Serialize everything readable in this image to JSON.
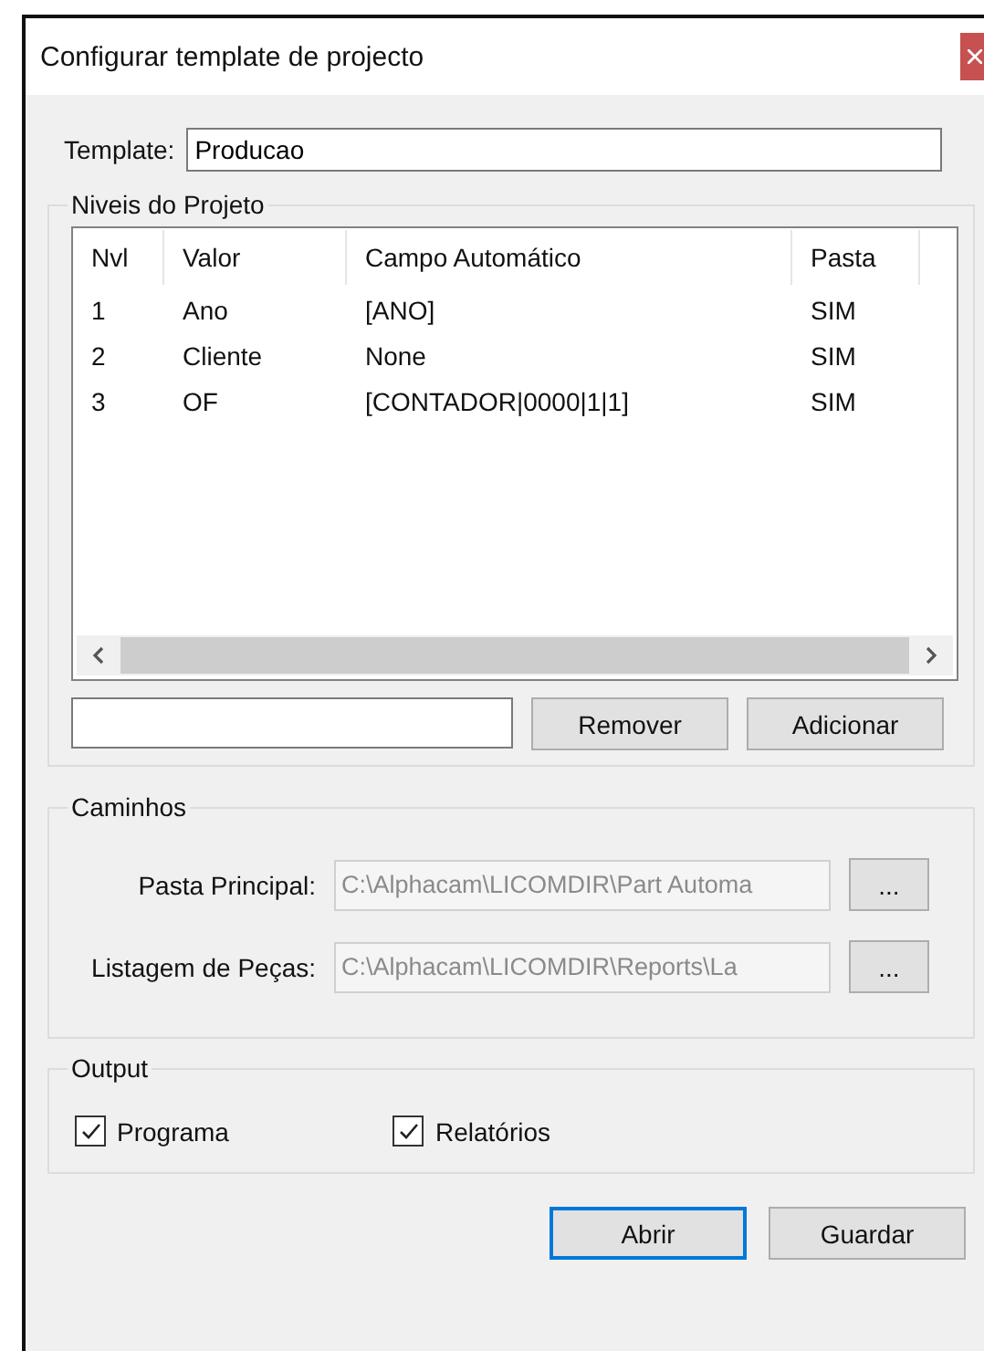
{
  "window": {
    "title": "Configurar template de projecto"
  },
  "template": {
    "label": "Template:",
    "value": "Producao"
  },
  "levels": {
    "title": "Niveis do Projeto",
    "columns": [
      "Nvl",
      "Valor",
      "Campo Automático",
      "Pasta"
    ],
    "rows": [
      [
        "1",
        "Ano",
        "[ANO]",
        "SIM"
      ],
      [
        "2",
        "Cliente",
        "None",
        "SIM"
      ],
      [
        "3",
        "OF",
        "[CONTADOR|0000|1|1]",
        "SIM"
      ]
    ],
    "buttons": [
      "Remover",
      "Adicionar"
    ]
  },
  "paths": {
    "title": "Caminhos",
    "fields": [
      {
        "label": "Pasta Principal:",
        "value": "C:\\Alphacam\\LICOMDIR\\Part Automa",
        "disabled": true,
        "button": "..."
      },
      {
        "label": "Listagem de Peças:",
        "value": "C:\\Alphacam\\LICOMDIR\\Reports\\La",
        "disabled": true,
        "button": "..."
      }
    ]
  },
  "output": {
    "title": "Output",
    "options": [
      {
        "label": "Programa",
        "checked": true
      },
      {
        "label": "Relatórios",
        "checked": true
      }
    ]
  },
  "buttons": [
    {
      "label": "Abrir",
      "selected": true
    },
    {
      "label": "Guardar",
      "selected": false
    }
  ]
}
